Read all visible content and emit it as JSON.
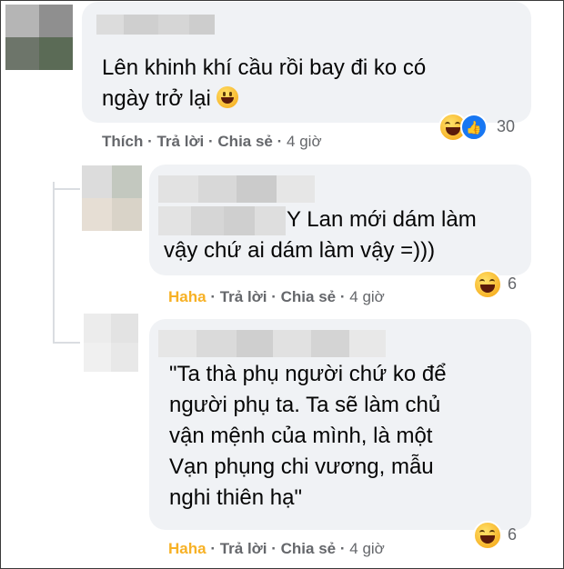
{
  "comments": [
    {
      "text_lines": [
        "Lên khinh khí cầu rồi bay đi ko có",
        "ngày trở lại"
      ],
      "inline_emoji": "grinning-face-icon",
      "reaction_count": "30",
      "reactions": [
        "haha-icon",
        "like-icon"
      ],
      "actions": {
        "like": "Thích",
        "reply": "Trả lời",
        "share": "Chia sẻ",
        "time": "4 giờ"
      }
    },
    {
      "text_lines": [
        "Y Lan mới dám làm",
        "vậy chứ ai dám làm vậy =)))"
      ],
      "reaction_count": "6",
      "reactions": [
        "haha-icon"
      ],
      "actions": {
        "like": "Haha",
        "reply": "Trả lời",
        "share": "Chia sẻ",
        "time": "4 giờ"
      }
    },
    {
      "text_lines": [
        "\"Ta thà phụ người chứ ko để",
        "người phụ ta. Ta sẽ làm chủ",
        "vận mệnh của mình, là một",
        "Vạn phụng chi vương, mẫu",
        "nghi thiên hạ\""
      ],
      "reaction_count": "6",
      "reactions": [
        "haha-icon"
      ],
      "actions": {
        "like": "Haha",
        "reply": "Trả lời",
        "share": "Chia sẻ",
        "time": "4 giờ"
      }
    }
  ],
  "separator": "·",
  "colors": {
    "bubble": "#f0f2f5",
    "meta": "#65676b",
    "haha": "#f7b125",
    "like_blue": "#1877f2"
  }
}
